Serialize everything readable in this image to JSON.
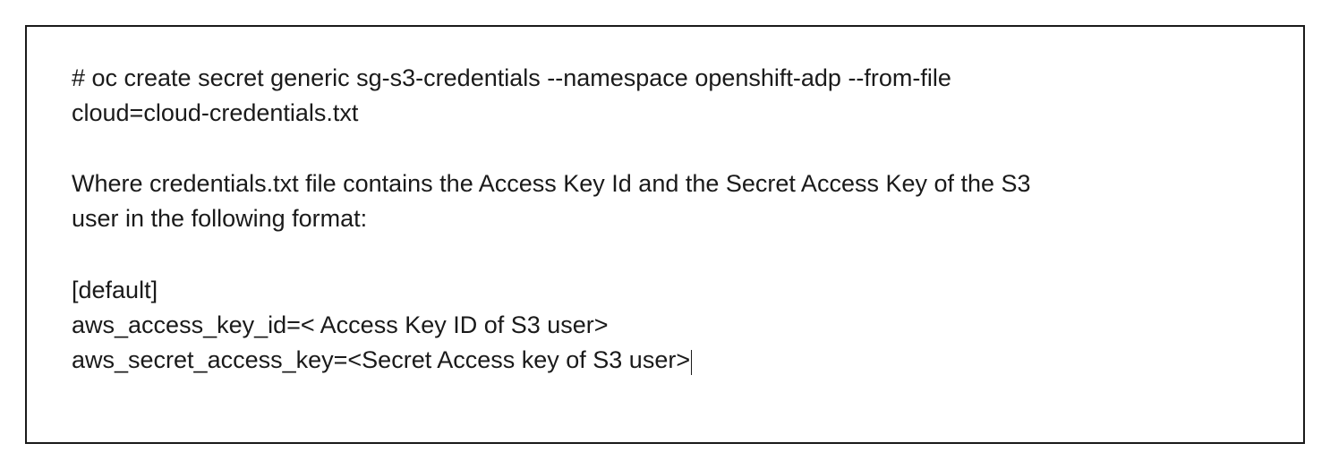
{
  "doc": {
    "command_line1": "# oc create secret generic sg-s3-credentials --namespace openshift-adp --from-file",
    "command_line2": "cloud=cloud-credentials.txt",
    "description_line1": "Where credentials.txt file contains the Access Key Id and the Secret Access Key of the S3",
    "description_line2": "user in the following format:",
    "cred_line1": "[default]",
    "cred_line2": "aws_access_key_id=< Access Key ID of S3 user>",
    "cred_line3": "aws_secret_access_key=<Secret Access key of S3 user>"
  }
}
